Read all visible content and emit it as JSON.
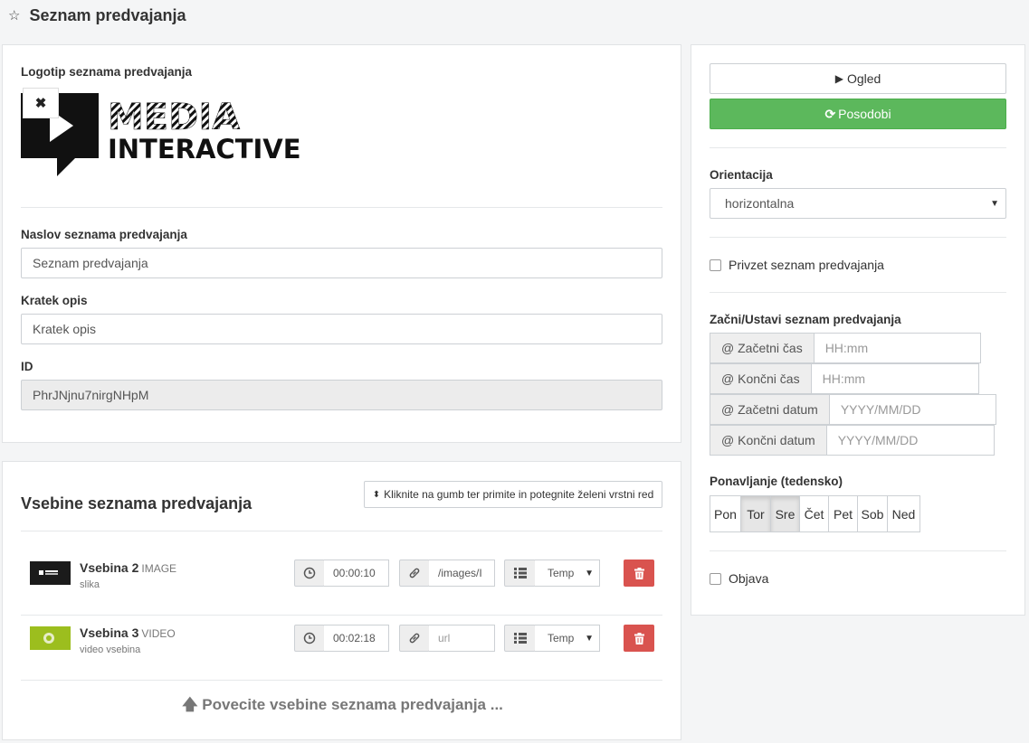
{
  "header": {
    "title": "Seznam predvajanja"
  },
  "main": {
    "logo_label": "Logotip seznama predvajanja",
    "logo": {
      "line1": "MEDIA",
      "line2": "INTERACTIVE"
    },
    "title_label": "Naslov seznama predvajanja",
    "title_value": "Seznam predvajanja",
    "desc_label": "Kratek opis",
    "desc_placeholder": "Kratek opis",
    "id_label": "ID",
    "id_value": "PhrJNjnu7nirgNHpM"
  },
  "items": {
    "title": "Vsebine seznama predvajanja",
    "sort_hint": "Kliknite na gumb ter primite in potegnite želeni vrstni red",
    "list": [
      {
        "name": "Vsebina 2",
        "type": "IMAGE",
        "sub": "slika",
        "duration": "00:00:10",
        "url": "/images/I",
        "url_is_placeholder": false,
        "template": "Temp"
      },
      {
        "name": "Vsebina 3",
        "type": "VIDEO",
        "sub": "video vsebina",
        "duration": "00:02:18",
        "url": "url",
        "url_is_placeholder": true,
        "template": "Temp"
      }
    ],
    "promote": "Povecite vsebine seznama predvajanja ..."
  },
  "side": {
    "preview_label": "Ogled",
    "update_label": "Posodobi",
    "orientation_label": "Orientacija",
    "orientation_value": "horizontalna",
    "default_label": "Privzet seznam predvajanja",
    "schedule_label": "Začni/Ustavi seznam predvajanja",
    "start_time_label": "@ Začetni čas",
    "start_time_placeholder": "HH:mm",
    "end_time_label": "@ Končni čas",
    "end_time_placeholder": "HH:mm",
    "start_date_label": "@ Začetni datum",
    "start_date_placeholder": "YYYY/MM/DD",
    "end_date_label": "@ Končni datum",
    "end_date_placeholder": "YYYY/MM/DD",
    "repeat_label": "Ponavljanje (tedensko)",
    "days": [
      {
        "label": "Pon",
        "active": false
      },
      {
        "label": "Tor",
        "active": true
      },
      {
        "label": "Sre",
        "active": true
      },
      {
        "label": "Čet",
        "active": false
      },
      {
        "label": "Pet",
        "active": false
      },
      {
        "label": "Sob",
        "active": false
      },
      {
        "label": "Ned",
        "active": false
      }
    ],
    "publish_label": "Objava"
  },
  "colors": {
    "success": "#5cb85c",
    "danger": "#d9534f",
    "border": "#ccd0d4"
  }
}
